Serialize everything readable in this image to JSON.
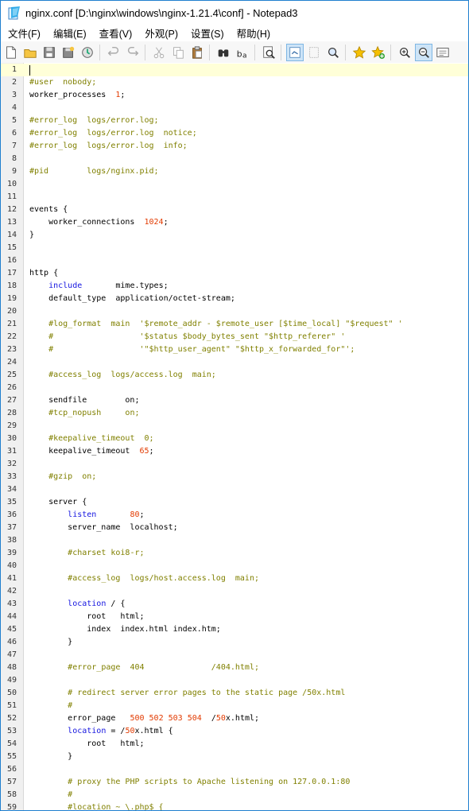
{
  "window": {
    "title": "nginx.conf [D:\\nginx\\windows\\nginx-1.21.4\\conf] - Notepad3"
  },
  "menu": [
    "文件(F)",
    "编辑(E)",
    "查看(V)",
    "外观(P)",
    "设置(S)",
    "帮助(H)"
  ],
  "toolbar": {
    "icons": [
      "new-file-icon",
      "open-folder-icon",
      "save-icon",
      "save-as-icon",
      "browse-icon",
      "undo-icon",
      "redo-icon",
      "cut-icon",
      "copy-icon",
      "paste-icon",
      "find-icon",
      "replace-icon",
      "search-page-icon",
      "word-wrap-icon",
      "column-select-icon",
      "zoom-find-icon",
      "favorite-icon",
      "add-favorite-icon",
      "zoom-in-icon",
      "zoom-out-icon",
      "settings-panel-icon"
    ]
  },
  "editor": {
    "current_line": 1,
    "lines": [
      {
        "n": "1",
        "text": ""
      },
      {
        "n": "2",
        "text": "#user  nobody;"
      },
      {
        "n": "3",
        "text": "worker_processes  1;"
      },
      {
        "n": "4",
        "text": ""
      },
      {
        "n": "5",
        "text": "#error_log  logs/error.log;"
      },
      {
        "n": "6",
        "text": "#error_log  logs/error.log  notice;"
      },
      {
        "n": "7",
        "text": "#error_log  logs/error.log  info;"
      },
      {
        "n": "8",
        "text": ""
      },
      {
        "n": "9",
        "text": "#pid        logs/nginx.pid;"
      },
      {
        "n": "10",
        "text": ""
      },
      {
        "n": "11",
        "text": ""
      },
      {
        "n": "12",
        "text": "events {"
      },
      {
        "n": "13",
        "text": "    worker_connections  1024;"
      },
      {
        "n": "14",
        "text": "}"
      },
      {
        "n": "15",
        "text": ""
      },
      {
        "n": "16",
        "text": ""
      },
      {
        "n": "17",
        "text": "http {"
      },
      {
        "n": "18",
        "text": "    include       mime.types;"
      },
      {
        "n": "19",
        "text": "    default_type  application/octet-stream;"
      },
      {
        "n": "20",
        "text": ""
      },
      {
        "n": "21",
        "text": "    #log_format  main  '$remote_addr - $remote_user [$time_local] \"$request\" '"
      },
      {
        "n": "22",
        "text": "    #                  '$status $body_bytes_sent \"$http_referer\" '"
      },
      {
        "n": "23",
        "text": "    #                  '\"$http_user_agent\" \"$http_x_forwarded_for\"';"
      },
      {
        "n": "24",
        "text": ""
      },
      {
        "n": "25",
        "text": "    #access_log  logs/access.log  main;"
      },
      {
        "n": "26",
        "text": ""
      },
      {
        "n": "27",
        "text": "    sendfile        on;"
      },
      {
        "n": "28",
        "text": "    #tcp_nopush     on;"
      },
      {
        "n": "29",
        "text": ""
      },
      {
        "n": "30",
        "text": "    #keepalive_timeout  0;"
      },
      {
        "n": "31",
        "text": "    keepalive_timeout  65;"
      },
      {
        "n": "32",
        "text": ""
      },
      {
        "n": "33",
        "text": "    #gzip  on;"
      },
      {
        "n": "34",
        "text": ""
      },
      {
        "n": "35",
        "text": "    server {"
      },
      {
        "n": "36",
        "text": "        listen       80;"
      },
      {
        "n": "37",
        "text": "        server_name  localhost;"
      },
      {
        "n": "38",
        "text": ""
      },
      {
        "n": "39",
        "text": "        #charset koi8-r;"
      },
      {
        "n": "40",
        "text": ""
      },
      {
        "n": "41",
        "text": "        #access_log  logs/host.access.log  main;"
      },
      {
        "n": "42",
        "text": ""
      },
      {
        "n": "43",
        "text": "        location / {"
      },
      {
        "n": "44",
        "text": "            root   html;"
      },
      {
        "n": "45",
        "text": "            index  index.html index.htm;"
      },
      {
        "n": "46",
        "text": "        }"
      },
      {
        "n": "47",
        "text": ""
      },
      {
        "n": "48",
        "text": "        #error_page  404              /404.html;"
      },
      {
        "n": "49",
        "text": ""
      },
      {
        "n": "50",
        "text": "        # redirect server error pages to the static page /50x.html"
      },
      {
        "n": "51",
        "text": "        #"
      },
      {
        "n": "52",
        "text": "        error_page   500 502 503 504  /50x.html;"
      },
      {
        "n": "53",
        "text": "        location = /50x.html {"
      },
      {
        "n": "54",
        "text": "            root   html;"
      },
      {
        "n": "55",
        "text": "        }"
      },
      {
        "n": "56",
        "text": ""
      },
      {
        "n": "57",
        "text": "        # proxy the PHP scripts to Apache listening on 127.0.0.1:80"
      },
      {
        "n": "58",
        "text": "        #"
      },
      {
        "n": "59",
        "text": "        #location ~ \\.php$ {"
      }
    ]
  },
  "colors": {
    "comment": "#808000",
    "keyword": "#1515e0",
    "number": "#e23a00",
    "current_line": "#ffffd8",
    "window_border": "#1f7fcf"
  }
}
